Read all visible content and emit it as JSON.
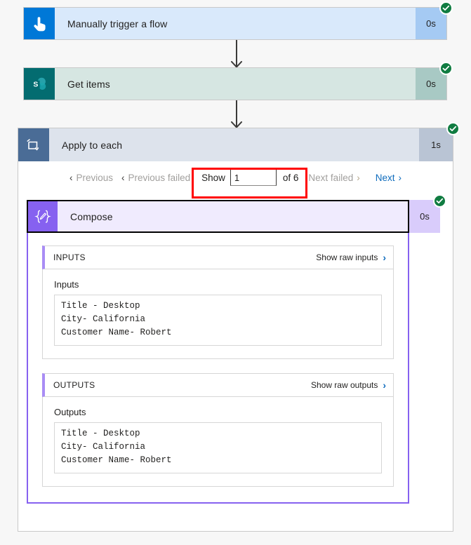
{
  "flow": {
    "trigger": {
      "title": "Manually trigger a flow",
      "duration": "0s",
      "status": "succeeded",
      "icon": "touch-hand-icon"
    },
    "get_items": {
      "title": "Get items",
      "duration": "0s",
      "status": "succeeded",
      "icon": "sharepoint-icon"
    },
    "apply_to_each": {
      "title": "Apply to each",
      "duration": "1s",
      "status": "succeeded",
      "icon": "loop-icon"
    },
    "compose": {
      "title": "Compose",
      "duration": "0s",
      "status": "succeeded",
      "icon": "compose-braces-icon"
    }
  },
  "pager": {
    "previous_label": "Previous",
    "previous_failed_label": "Previous failed",
    "show_label": "Show",
    "current_page": "1",
    "of_label": "of 6",
    "total_pages": 6,
    "next_failed_label": "Next failed",
    "next_label": "Next",
    "chevron_left": "‹",
    "chevron_right": "›"
  },
  "inputs_section": {
    "header": "INPUTS",
    "raw_link": "Show raw inputs",
    "label": "Inputs",
    "value": "Title - Desktop\nCity- California\nCustomer Name- Robert"
  },
  "outputs_section": {
    "header": "OUTPUTS",
    "raw_link": "Show raw outputs",
    "label": "Outputs",
    "value": "Title - Desktop\nCity- California\nCustomer Name- Robert"
  },
  "colors": {
    "trigger_accent": "#0078d7",
    "sharepoint_accent": "#036c70",
    "loop_accent": "#4a6c96",
    "compose_accent": "#8661f0",
    "success_badge": "#107c41",
    "link_blue": "#0f6cbd",
    "highlight_red": "#ff0000",
    "disabled_grey": "#a19f9d"
  }
}
